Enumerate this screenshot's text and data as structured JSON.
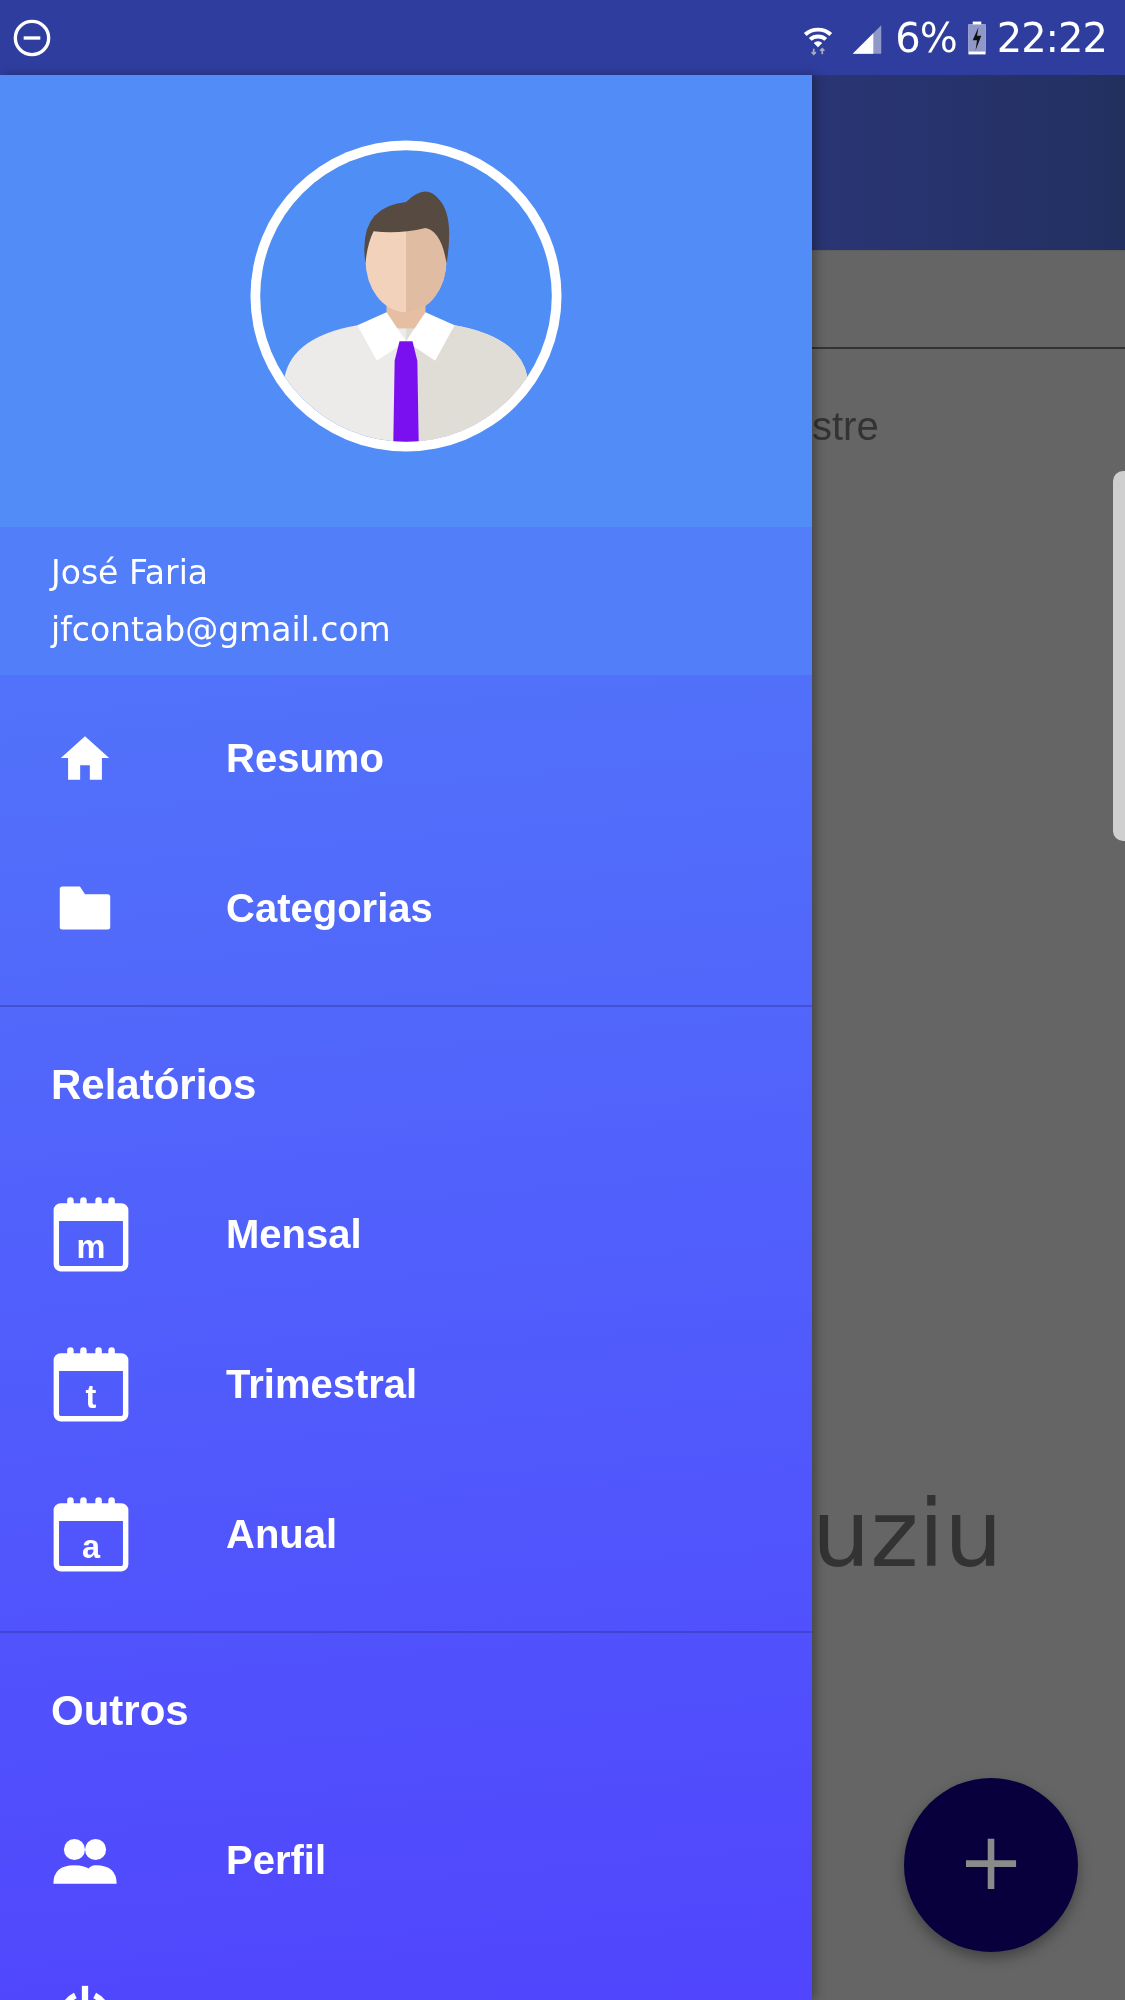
{
  "status_bar": {
    "battery": "6%",
    "time": "22:22"
  },
  "drawer": {
    "user": {
      "name": "José Faria",
      "email": "jfcontab@gmail.com"
    },
    "sections": [
      {
        "items": [
          {
            "kind": "home",
            "label": "Resumo"
          },
          {
            "kind": "folder",
            "label": "Categorias"
          }
        ]
      },
      {
        "title": "Relatórios",
        "items": [
          {
            "kind": "calendar",
            "icon_letter": "m",
            "label": "Mensal"
          },
          {
            "kind": "calendar",
            "icon_letter": "t",
            "label": "Trimestral"
          },
          {
            "kind": "calendar",
            "icon_letter": "a",
            "label": "Anual"
          }
        ]
      },
      {
        "title": "Outros",
        "items": [
          {
            "kind": "people",
            "label": "Perfil"
          },
          {
            "kind": "power"
          }
        ]
      }
    ]
  },
  "background": {
    "texts": [
      "stre",
      "uziu"
    ],
    "fab": "+"
  }
}
